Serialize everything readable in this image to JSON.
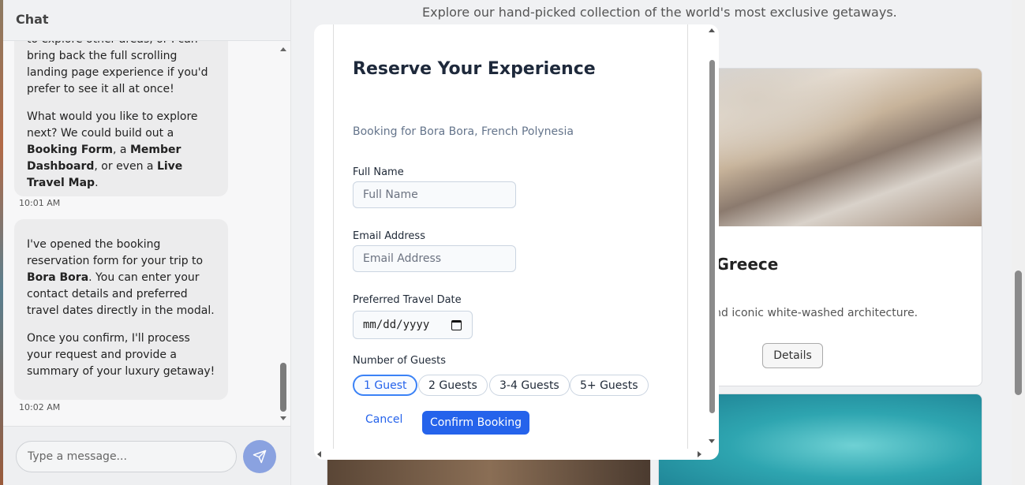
{
  "chat": {
    "title": "Chat",
    "messages": [
      {
        "paragraphs": [
          [
            {
              "t": "to explore other areas, or I can bring back the full scrolling landing page experience if you'd prefer to see it all at once!"
            }
          ],
          [
            {
              "t": "What would you like to explore next? We could build out a "
            },
            {
              "t": "Booking Form",
              "b": true
            },
            {
              "t": ", a "
            },
            {
              "t": "Member Dashboard",
              "b": true
            },
            {
              "t": ", or even a "
            },
            {
              "t": "Live Travel Map",
              "b": true
            },
            {
              "t": "."
            }
          ]
        ],
        "time": "10:01 AM"
      },
      {
        "paragraphs": [
          [
            {
              "t": "I've opened the booking reservation form for your trip to "
            },
            {
              "t": "Bora Bora",
              "b": true
            },
            {
              "t": ". You can enter your contact details and preferred travel dates directly in the modal."
            }
          ],
          [
            {
              "t": "Once you confirm, I'll process your request and provide a summary of your luxury getaway!"
            }
          ]
        ],
        "time": "10:02 AM"
      }
    ],
    "input_placeholder": "Type a message...",
    "send_icon": "send-icon"
  },
  "page": {
    "tagline": "Explore our hand-picked collection of the world's most exclusive getaways.",
    "cards": {
      "santorini": {
        "title": "ini, Greece",
        "description": "ters and iconic white-washed architecture.",
        "button": "Details"
      }
    }
  },
  "modal": {
    "title": "Reserve Your Experience",
    "subtitle": "Booking for Bora Bora, French Polynesia",
    "full_name": {
      "label": "Full Name",
      "placeholder": "Full Name",
      "value": ""
    },
    "email": {
      "label": "Email Address",
      "placeholder": "Email Address",
      "value": ""
    },
    "date": {
      "label": "Preferred Travel Date",
      "display": "mm/dd/yyyy"
    },
    "guests": {
      "label": "Number of Guests",
      "options": [
        "1 Guest",
        "2 Guests",
        "3-4 Guests",
        "5+ Guests"
      ],
      "selected": "1 Guest"
    },
    "cancel_label": "Cancel",
    "confirm_label": "Confirm Booking"
  },
  "colors": {
    "primary": "#2563eb",
    "send_button": "#8aa2e0",
    "chat_bubble": "#ececed"
  }
}
